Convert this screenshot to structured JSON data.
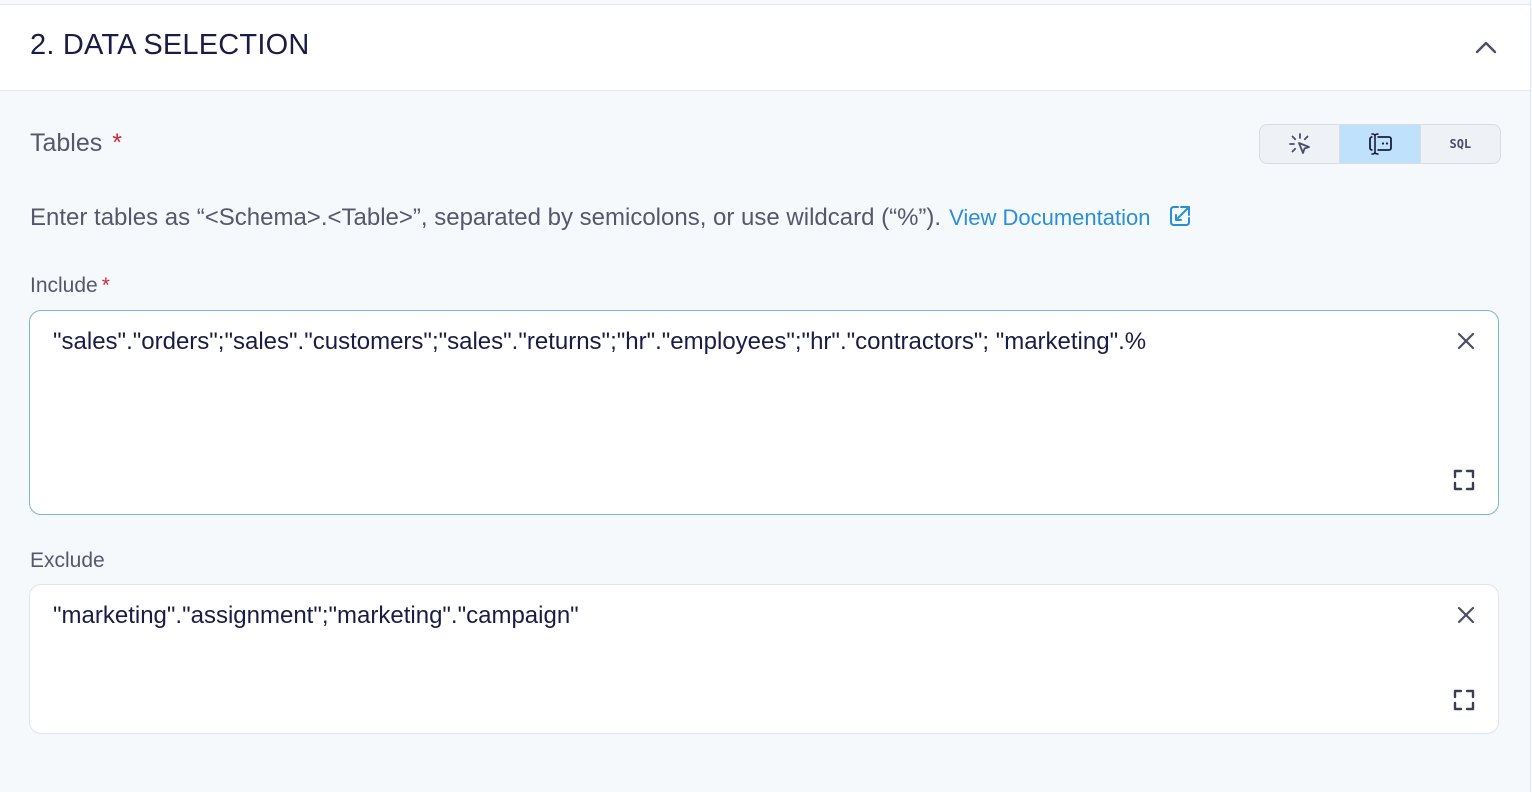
{
  "section": {
    "title": "2. DATA SELECTION",
    "collapse_icon": "chevron-up-icon"
  },
  "tables": {
    "label": "Tables",
    "required_mark": "*",
    "modes": [
      {
        "name": "visual",
        "icon": "pointer-click-icon",
        "active": false
      },
      {
        "name": "text",
        "icon": "text-cursor-icon",
        "active": true
      },
      {
        "name": "sql",
        "label": "SQL",
        "active": false
      }
    ],
    "help_text": "Enter tables as “<Schema>.<Table>”, separated by semicolons, or use wildcard (“%”).",
    "doc_link": "View Documentation",
    "doc_icon": "external-link-icon"
  },
  "include": {
    "label": "Include",
    "required_mark": "*",
    "value": "\"sales\".\"orders\";\"sales\".\"customers\";\"sales\".\"returns\";\"hr\".\"employees\";\"hr\".\"contractors\"; \"marketing\".%"
  },
  "exclude": {
    "label": "Exclude",
    "value": "\"marketing\".\"assignment\";\"marketing\".\"campaign\""
  },
  "colors": {
    "accent": "#2a8fd8",
    "active_toggle": "#bfe1fb",
    "required": "#c8283c"
  }
}
